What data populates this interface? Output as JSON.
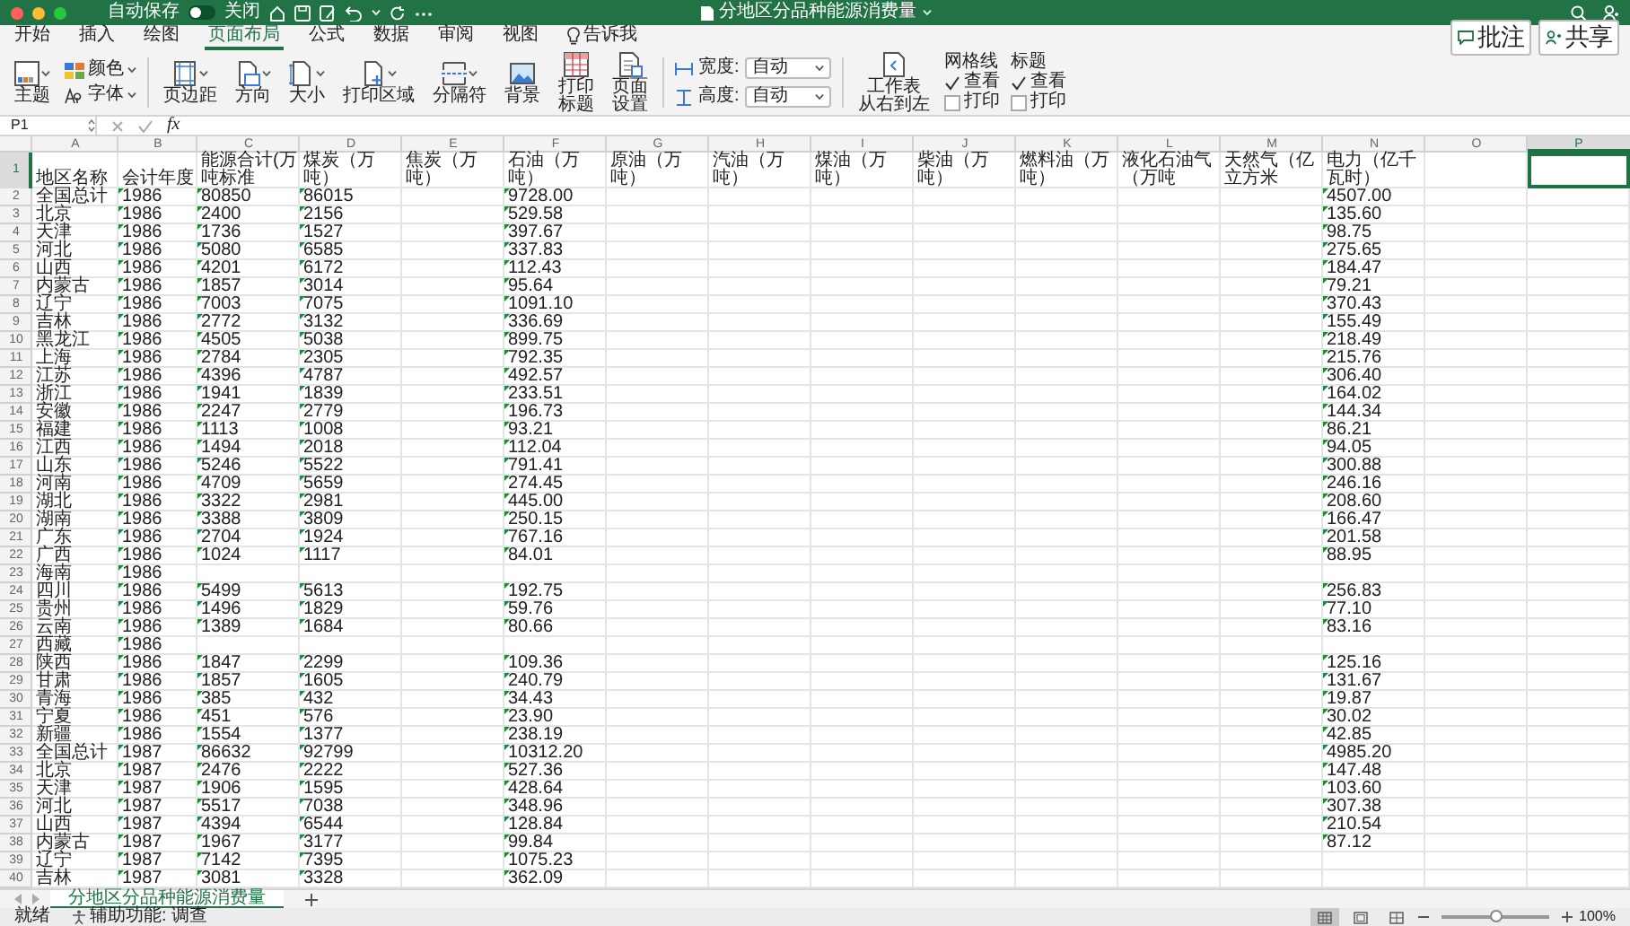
{
  "title_bar": {
    "autosave_label": "自动保存",
    "autosave": {
      "on": false,
      "label": "关闭"
    },
    "title": "分地区分品种能源消费量"
  },
  "tabs": [
    {
      "label": "开始",
      "selected": false
    },
    {
      "label": "插入",
      "selected": false
    },
    {
      "label": "绘图",
      "selected": false
    },
    {
      "label": "页面布局",
      "selected": true
    },
    {
      "label": "公式",
      "selected": false
    },
    {
      "label": "数据",
      "selected": false
    },
    {
      "label": "审阅",
      "selected": false
    },
    {
      "label": "视图",
      "selected": false
    }
  ],
  "tell_me": "告诉我",
  "comment_button": "批注",
  "share_button": "共享",
  "ribbon": {
    "theme": "主题",
    "colors": "颜色",
    "fonts": "字体",
    "page_setup": [
      [
        "页边距"
      ],
      [
        "方向"
      ],
      [
        "大小"
      ],
      [
        "打印区域"
      ],
      [
        "分隔符"
      ],
      [
        "背景"
      ],
      [
        "打印",
        "标题"
      ],
      [
        "页面",
        "设置"
      ]
    ],
    "scale": [
      {
        "label": "宽度:",
        "value": "自动"
      },
      {
        "label": "高度:",
        "value": "自动"
      }
    ],
    "sheet_direction": [
      "工作表",
      "从右到左"
    ],
    "options": [
      {
        "title": "网格线",
        "view": {
          "label": "查看",
          "checked": true
        },
        "print": {
          "label": "打印",
          "checked": false
        }
      },
      {
        "title": "标题",
        "view": {
          "label": "查看",
          "checked": true
        },
        "print": {
          "label": "打印",
          "checked": false
        }
      }
    ]
  },
  "formula_bar": {
    "name_box": "P1",
    "fx": "fx"
  },
  "grid": {
    "columns": [
      {
        "letter": "A",
        "selected": false
      },
      {
        "letter": "B",
        "selected": false
      },
      {
        "letter": "C",
        "selected": false
      },
      {
        "letter": "D",
        "selected": false
      },
      {
        "letter": "E",
        "selected": false
      },
      {
        "letter": "F",
        "selected": false
      },
      {
        "letter": "G",
        "selected": false
      },
      {
        "letter": "H",
        "selected": false
      },
      {
        "letter": "I",
        "selected": false
      },
      {
        "letter": "J",
        "selected": false
      },
      {
        "letter": "K",
        "selected": false
      },
      {
        "letter": "L",
        "selected": false
      },
      {
        "letter": "M",
        "selected": false
      },
      {
        "letter": "N",
        "selected": false
      },
      {
        "letter": "O",
        "selected": false
      },
      {
        "letter": "P",
        "selected": true
      }
    ],
    "rows": [
      {
        "num": "1",
        "selected": true,
        "marks": false,
        "cells": {
          "A": "地区名称",
          "B": "会计年度",
          "C": "能源合计(万吨标准",
          "D": "煤炭（万吨）",
          "E": "焦炭（万吨）",
          "F": "石油（万吨）",
          "G": "原油（万吨）",
          "H": "汽油（万吨）",
          "I": "煤油（万吨）",
          "J": "柴油（万吨）",
          "K": "燃料油（万吨）",
          "L": "液化石油气（万吨",
          "M": "天然气（亿立方米",
          "N": "电力（亿千瓦时）"
        }
      },
      {
        "num": "2",
        "selected": false,
        "marks": true,
        "cells": {
          "A": "全国总计",
          "B": "1986",
          "C": "80850",
          "D": "86015",
          "F": "9728.00",
          "N": "4507.00"
        }
      },
      {
        "num": "3",
        "selected": false,
        "marks": true,
        "cells": {
          "A": "北京",
          "B": "1986",
          "C": "2400",
          "D": "2156",
          "F": "529.58",
          "N": "135.60"
        }
      },
      {
        "num": "4",
        "selected": false,
        "marks": true,
        "cells": {
          "A": "天津",
          "B": "1986",
          "C": "1736",
          "D": "1527",
          "F": "397.67",
          "N": "98.75"
        }
      },
      {
        "num": "5",
        "selected": false,
        "marks": true,
        "cells": {
          "A": "河北",
          "B": "1986",
          "C": "5080",
          "D": "6585",
          "F": "337.83",
          "N": "275.65"
        }
      },
      {
        "num": "6",
        "selected": false,
        "marks": true,
        "cells": {
          "A": "山西",
          "B": "1986",
          "C": "4201",
          "D": "6172",
          "F": "112.43",
          "N": "184.47"
        }
      },
      {
        "num": "7",
        "selected": false,
        "marks": true,
        "cells": {
          "A": "内蒙古",
          "B": "1986",
          "C": "1857",
          "D": "3014",
          "F": "95.64",
          "N": "79.21"
        }
      },
      {
        "num": "8",
        "selected": false,
        "marks": true,
        "cells": {
          "A": "辽宁",
          "B": "1986",
          "C": "7003",
          "D": "7075",
          "F": "1091.10",
          "N": "370.43"
        }
      },
      {
        "num": "9",
        "selected": false,
        "marks": true,
        "cells": {
          "A": "吉林",
          "B": "1986",
          "C": "2772",
          "D": "3132",
          "F": "336.69",
          "N": "155.49"
        }
      },
      {
        "num": "10",
        "selected": false,
        "marks": true,
        "cells": {
          "A": "黑龙江",
          "B": "1986",
          "C": "4505",
          "D": "5038",
          "F": "899.75",
          "N": "218.49"
        }
      },
      {
        "num": "11",
        "selected": false,
        "marks": true,
        "cells": {
          "A": "上海",
          "B": "1986",
          "C": "2784",
          "D": "2305",
          "F": "792.35",
          "N": "215.76"
        }
      },
      {
        "num": "12",
        "selected": false,
        "marks": true,
        "cells": {
          "A": "江苏",
          "B": "1986",
          "C": "4396",
          "D": "4787",
          "F": "492.57",
          "N": "306.40"
        }
      },
      {
        "num": "13",
        "selected": false,
        "marks": true,
        "cells": {
          "A": "浙江",
          "B": "1986",
          "C": "1941",
          "D": "1839",
          "F": "233.51",
          "N": "164.02"
        }
      },
      {
        "num": "14",
        "selected": false,
        "marks": true,
        "cells": {
          "A": "安徽",
          "B": "1986",
          "C": "2247",
          "D": "2779",
          "F": "196.73",
          "N": "144.34"
        }
      },
      {
        "num": "15",
        "selected": false,
        "marks": true,
        "cells": {
          "A": "福建",
          "B": "1986",
          "C": "1113",
          "D": "1008",
          "F": "93.21",
          "N": "86.21"
        }
      },
      {
        "num": "16",
        "selected": false,
        "marks": true,
        "cells": {
          "A": "江西",
          "B": "1986",
          "C": "1494",
          "D": "2018",
          "F": "112.04",
          "N": "94.05"
        }
      },
      {
        "num": "17",
        "selected": false,
        "marks": true,
        "cells": {
          "A": "山东",
          "B": "1986",
          "C": "5246",
          "D": "5522",
          "F": "791.41",
          "N": "300.88"
        }
      },
      {
        "num": "18",
        "selected": false,
        "marks": true,
        "cells": {
          "A": "河南",
          "B": "1986",
          "C": "4709",
          "D": "5659",
          "F": "274.45",
          "N": "246.16"
        }
      },
      {
        "num": "19",
        "selected": false,
        "marks": true,
        "cells": {
          "A": "湖北",
          "B": "1986",
          "C": "3322",
          "D": "2981",
          "F": "445.00",
          "N": "208.60"
        }
      },
      {
        "num": "20",
        "selected": false,
        "marks": true,
        "cells": {
          "A": "湖南",
          "B": "1986",
          "C": "3388",
          "D": "3809",
          "F": "250.15",
          "N": "166.47"
        }
      },
      {
        "num": "21",
        "selected": false,
        "marks": true,
        "cells": {
          "A": "广东",
          "B": "1986",
          "C": "2704",
          "D": "1924",
          "F": "767.16",
          "N": "201.58"
        }
      },
      {
        "num": "22",
        "selected": false,
        "marks": true,
        "cells": {
          "A": "广西",
          "B": "1986",
          "C": "1024",
          "D": "1117",
          "F": "84.01",
          "N": "88.95"
        }
      },
      {
        "num": "23",
        "selected": false,
        "marks": true,
        "cells": {
          "A": "海南",
          "B": "1986"
        }
      },
      {
        "num": "24",
        "selected": false,
        "marks": true,
        "cells": {
          "A": "四川",
          "B": "1986",
          "C": "5499",
          "D": "5613",
          "F": "192.75",
          "N": "256.83"
        }
      },
      {
        "num": "25",
        "selected": false,
        "marks": true,
        "cells": {
          "A": "贵州",
          "B": "1986",
          "C": "1496",
          "D": "1829",
          "F": "59.76",
          "N": "77.10"
        }
      },
      {
        "num": "26",
        "selected": false,
        "marks": true,
        "cells": {
          "A": "云南",
          "B": "1986",
          "C": "1389",
          "D": "1684",
          "F": "80.66",
          "N": "83.16"
        }
      },
      {
        "num": "27",
        "selected": false,
        "marks": true,
        "cells": {
          "A": "西藏",
          "B": "1986"
        }
      },
      {
        "num": "28",
        "selected": false,
        "marks": true,
        "cells": {
          "A": "陕西",
          "B": "1986",
          "C": "1847",
          "D": "2299",
          "F": "109.36",
          "N": "125.16"
        }
      },
      {
        "num": "29",
        "selected": false,
        "marks": true,
        "cells": {
          "A": "甘肃",
          "B": "1986",
          "C": "1857",
          "D": "1605",
          "F": "240.79",
          "N": "131.67"
        }
      },
      {
        "num": "30",
        "selected": false,
        "marks": true,
        "cells": {
          "A": "青海",
          "B": "1986",
          "C": "385",
          "D": "432",
          "F": "34.43",
          "N": "19.87"
        }
      },
      {
        "num": "31",
        "selected": false,
        "marks": true,
        "cells": {
          "A": "宁夏",
          "B": "1986",
          "C": "451",
          "D": "576",
          "F": "23.90",
          "N": "30.02"
        }
      },
      {
        "num": "32",
        "selected": false,
        "marks": true,
        "cells": {
          "A": "新疆",
          "B": "1986",
          "C": "1554",
          "D": "1377",
          "F": "238.19",
          "N": "42.85"
        }
      },
      {
        "num": "33",
        "selected": false,
        "marks": true,
        "cells": {
          "A": "全国总计",
          "B": "1987",
          "C": "86632",
          "D": "92799",
          "F": "10312.20",
          "N": "4985.20"
        }
      },
      {
        "num": "34",
        "selected": false,
        "marks": true,
        "cells": {
          "A": "北京",
          "B": "1987",
          "C": "2476",
          "D": "2222",
          "F": "527.36",
          "N": "147.48"
        }
      },
      {
        "num": "35",
        "selected": false,
        "marks": true,
        "cells": {
          "A": "天津",
          "B": "1987",
          "C": "1906",
          "D": "1595",
          "F": "428.64",
          "N": "103.60"
        }
      },
      {
        "num": "36",
        "selected": false,
        "marks": true,
        "cells": {
          "A": "河北",
          "B": "1987",
          "C": "5517",
          "D": "7038",
          "F": "348.96",
          "N": "307.38"
        }
      },
      {
        "num": "37",
        "selected": false,
        "marks": true,
        "cells": {
          "A": "山西",
          "B": "1987",
          "C": "4394",
          "D": "6544",
          "F": "128.84",
          "N": "210.54"
        }
      },
      {
        "num": "38",
        "selected": false,
        "marks": true,
        "cells": {
          "A": "内蒙古",
          "B": "1987",
          "C": "1967",
          "D": "3177",
          "F": "99.84",
          "N": "87.12"
        }
      },
      {
        "num": "39",
        "selected": false,
        "marks": true,
        "cells": {
          "A": "辽宁",
          "B": "1987",
          "C": "7142",
          "D": "7395",
          "F": "1075.23"
        }
      },
      {
        "num": "40",
        "selected": false,
        "marks": true,
        "cells": {
          "A": "吉林",
          "B": "1987",
          "C": "3081",
          "D": "3328",
          "F": "362.09"
        }
      }
    ]
  },
  "sheets": [
    {
      "label": "分地区分品种能源消费量",
      "selected": true
    }
  ],
  "status": {
    "ready": "就绪",
    "accessibility": "辅助功能: 调查",
    "views": [
      {
        "selected": true
      },
      {
        "selected": false
      },
      {
        "selected": false
      }
    ],
    "zoom": {
      "level": 0.5,
      "reading": "100%"
    }
  }
}
